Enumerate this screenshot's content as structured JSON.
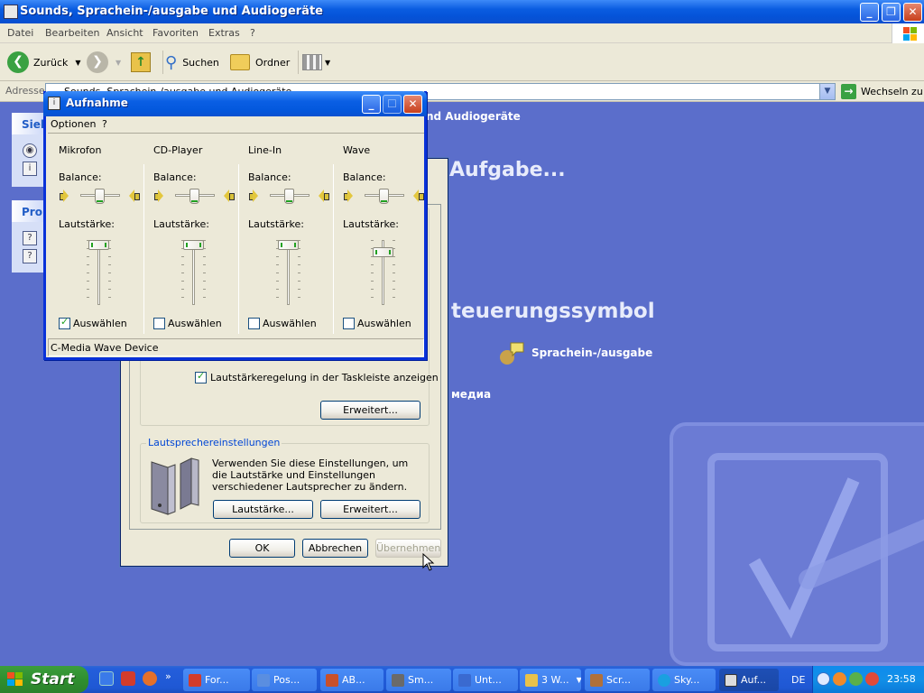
{
  "explorer": {
    "title": "Sounds, Sprachein-/ausgabe und Audiogeräte",
    "menu": [
      "Datei",
      "Bearbeiten",
      "Ansicht",
      "Favoriten",
      "Extras",
      "?"
    ],
    "toolbar": {
      "back_label": "Zurück",
      "search_label": "Suchen",
      "folders_label": "Ordner"
    },
    "address": {
      "label": "Adresse",
      "value": "Sounds, Sprachein-/ausgabe und Audiogeräte",
      "go_label": "Wechseln zu"
    },
    "side_panels": [
      {
        "heading": "Sieh"
      },
      {
        "heading": "Prob"
      }
    ],
    "content": {
      "header_fragment": "nd Audiogeräte",
      "task_heading_fragment": "Aufgabe...",
      "section_heading_fragment": "teuerungssymbol",
      "link_speech": "Sprachein-/ausgabe",
      "link_fragment": "медиа"
    }
  },
  "sound_dialog": {
    "taskbar_checkbox_label": "Lautstärkeregelung in der Taskleiste anzeigen",
    "taskbar_checkbox_checked": true,
    "advanced_button": "Erweitert...",
    "speaker_group_label": "Lautsprechereinstellungen",
    "speaker_text": "Verwenden Sie diese Einstellungen, um die Lautstärke und Einstellungen verschiedener Lautsprecher zu ändern.",
    "speaker_volume_button": "Lautstärke...",
    "speaker_advanced_button": "Erweitert...",
    "ok_button": "OK",
    "cancel_button": "Abbrechen",
    "apply_button": "Übernehmen"
  },
  "aufnahme": {
    "title": "Aufnahme",
    "menu": [
      "Optionen",
      "?"
    ],
    "balance_label": "Balance:",
    "volume_label": "Lautstärke:",
    "select_label": "Auswählen",
    "channels": [
      {
        "name": "Mikrofon",
        "balance": 0.5,
        "volume": 1.0,
        "selected": true
      },
      {
        "name": "CD-Player",
        "balance": 0.5,
        "volume": 1.0,
        "selected": false
      },
      {
        "name": "Line-In",
        "balance": 0.5,
        "volume": 1.0,
        "selected": false
      },
      {
        "name": "Wave",
        "balance": 0.5,
        "volume": 0.88,
        "selected": false
      }
    ],
    "status": "C-Media Wave Device"
  },
  "taskbar": {
    "start_label": "Start",
    "tasks": [
      {
        "label": "For...",
        "color": "#d23c2c"
      },
      {
        "label": "Pos...",
        "color": "#5a8ee0"
      },
      {
        "label": "AB...",
        "color": "#c8502a"
      },
      {
        "label": "Sm...",
        "color": "#6a6a6a"
      },
      {
        "label": "Unt...",
        "color": "#3a6ad0"
      },
      {
        "label": "3 W...",
        "color": "#e9c24a"
      },
      {
        "label": "Scr...",
        "color": "#b0703a"
      },
      {
        "label": "Sky...",
        "color": "#1aa0e0"
      },
      {
        "label": "Auf...",
        "color": "#dcdcdc"
      }
    ],
    "language": "DE",
    "clock": "23:58"
  }
}
